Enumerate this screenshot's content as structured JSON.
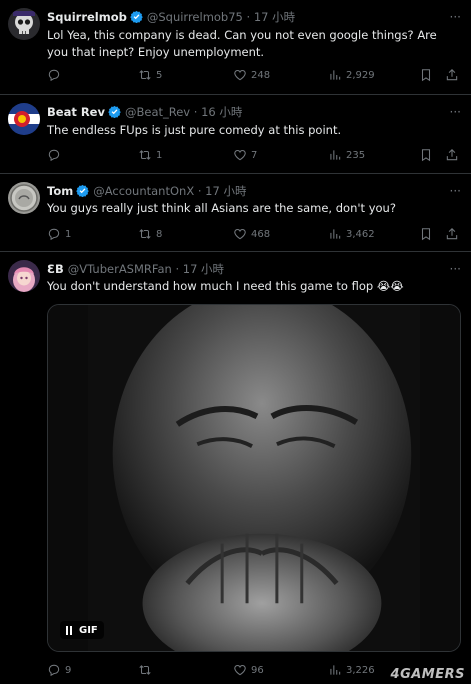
{
  "tweets": [
    {
      "name": "Squirrelmob",
      "handle": "@Squirrelmob75",
      "sep": "·",
      "time": "17 小時",
      "text": "Lol Yea, this company is dead. Can you not even google things? Are you that inept? Enjoy unemployment.",
      "replies": "",
      "retweets": "5",
      "likes": "248",
      "views": "2,929"
    },
    {
      "name": "Beat Rev",
      "handle": "@Beat_Rev",
      "sep": "·",
      "time": "16 小時",
      "text": "The endless FUps is just pure comedy at this point.",
      "replies": "",
      "retweets": "1",
      "likes": "7",
      "views": "235"
    },
    {
      "name": "Tom",
      "handle": "@AccountantOnX",
      "sep": "·",
      "time": "17 小時",
      "text": "You guys really just think all Asians are the same, don't you?",
      "replies": "1",
      "retweets": "8",
      "likes": "468",
      "views": "3,462"
    },
    {
      "name": "ƐB",
      "handle": "@VTuberASMRFan",
      "sep": "·",
      "time": "17 小時",
      "text": "You don't understand how much I need this game to flop 😭😭",
      "media_badge": "GIF",
      "replies": "9",
      "retweets": "",
      "likes": "96",
      "views": "3,226"
    }
  ],
  "more_label": "···",
  "watermark": "4GAMERS",
  "colors": {
    "background": "#000000",
    "text": "#e7e9ea",
    "muted": "#71767b",
    "divider": "#2f3336",
    "verified": "#1d9bf0"
  }
}
